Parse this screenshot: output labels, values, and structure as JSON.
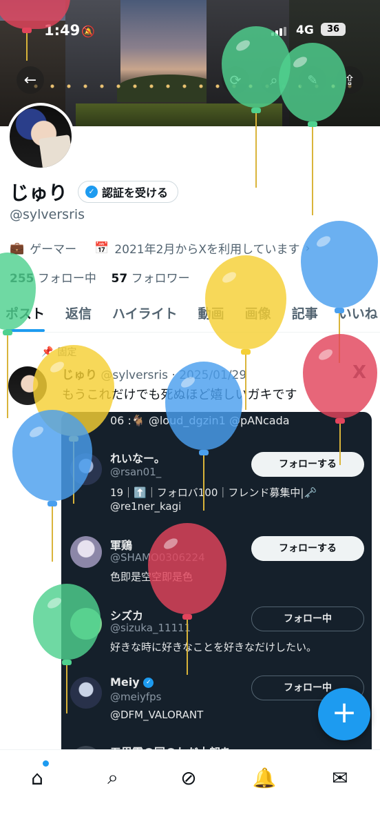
{
  "status": {
    "time": "1:49",
    "network": "4G",
    "battery": "36"
  },
  "profile": {
    "name": "じゅり",
    "verify_label": "認証を受ける",
    "handle": "@sylversris",
    "category": "ゲーマー",
    "joined": "2021年2月からXを利用しています",
    "following_count": "255",
    "following_label": "フォロー中",
    "followers_count": "57",
    "followers_label": "フォロワー"
  },
  "tabs": [
    "ポスト",
    "返信",
    "ハイライト",
    "動画",
    "画像",
    "記事",
    "いいね"
  ],
  "post": {
    "pinned_label": "固定",
    "author": "じゅり",
    "handle_date": "@sylversris · 2025/01/29",
    "text": "もうこれだけでも死ぬほど嬉しいガキです"
  },
  "embedded": {
    "top_line": "06 :🐐 @loud_dgzin1 @pANcada",
    "users": [
      {
        "name": "れいなー。",
        "handle": "@rsan01_",
        "bio": "19｜⬆️｜フォロバ100｜フレンド募集中|🗝️",
        "bio2": "@re1ner_kagi",
        "button": "フォローする"
      },
      {
        "name": "軍鶏",
        "handle": "@SHAMO0306224",
        "bio": "色即是空空即是色",
        "button": "フォローする"
      },
      {
        "name": "シズカ",
        "handle": "@sizuka_11111",
        "bio": "好きな時に好きなことを好きなだけしたい。",
        "button": "フォロー中"
      },
      {
        "name": "Meiy",
        "handle": "@meiyfps",
        "bio": "@DFM_VALORANT",
        "button": "フォロー中"
      },
      {
        "name": "五里霧の国のわだ大朗を"
      }
    ]
  },
  "colors": {
    "accent": "#1d9bf0",
    "dark_bg": "#15202b"
  },
  "icons": [
    "back-arrow-icon",
    "refresh-icon",
    "search-icon",
    "edit-icon",
    "share-icon",
    "briefcase-icon",
    "calendar-icon",
    "pin-icon",
    "x-logo-icon",
    "home-icon",
    "explore-icon",
    "grok-icon",
    "notifications-icon",
    "messages-icon",
    "plus-icon"
  ]
}
